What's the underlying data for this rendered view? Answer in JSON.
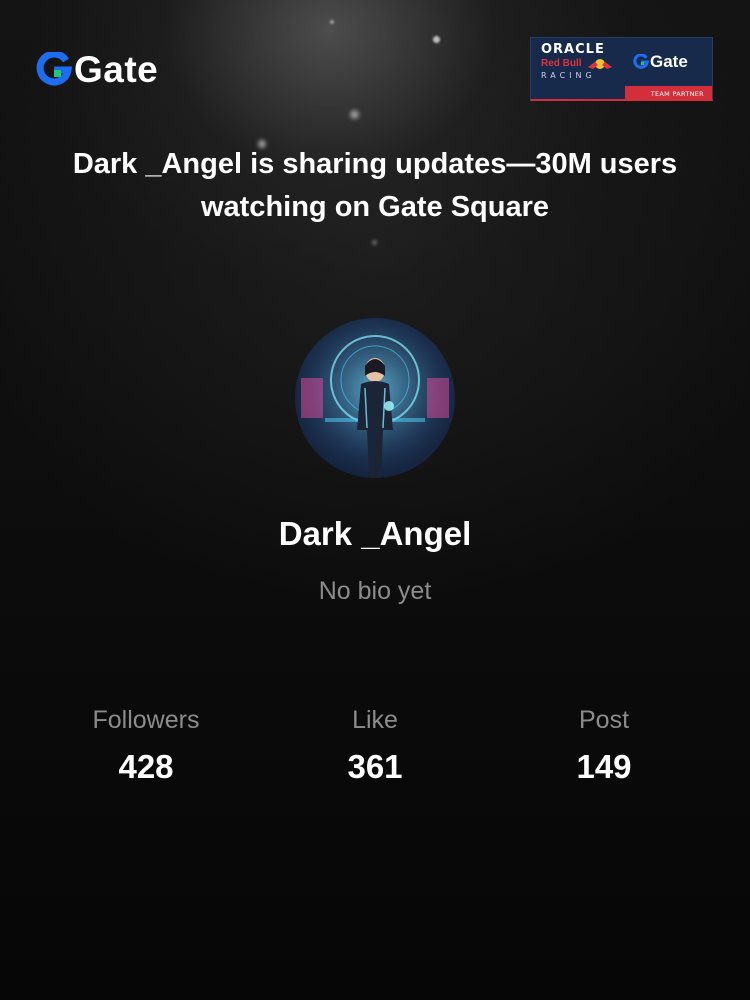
{
  "brand": {
    "name": "Gate",
    "accent": "#1e6cf0",
    "accent_green": "#1ec87a"
  },
  "partner_badge": {
    "oracle": "ORACLE",
    "red_bull": "Red Bull",
    "racing": "RACING",
    "gate": "Gate",
    "footer": "TEAM PARTNER"
  },
  "headline": "Dark _Angel  is sharing updates—30M users watching on Gate Square",
  "profile": {
    "username": "Dark _Angel",
    "bio": "No bio yet"
  },
  "stats": [
    {
      "label": "Followers",
      "value": "428"
    },
    {
      "label": "Like",
      "value": "361"
    },
    {
      "label": "Post",
      "value": "149"
    }
  ],
  "colors": {
    "background": "#0a0a0a",
    "muted_text": "#8c8c8c",
    "badge_navy": "#172a4b",
    "badge_red": "#d32f3b"
  },
  "icons": {
    "logo": "gate-logo-icon",
    "avatar": "user-avatar-image"
  }
}
